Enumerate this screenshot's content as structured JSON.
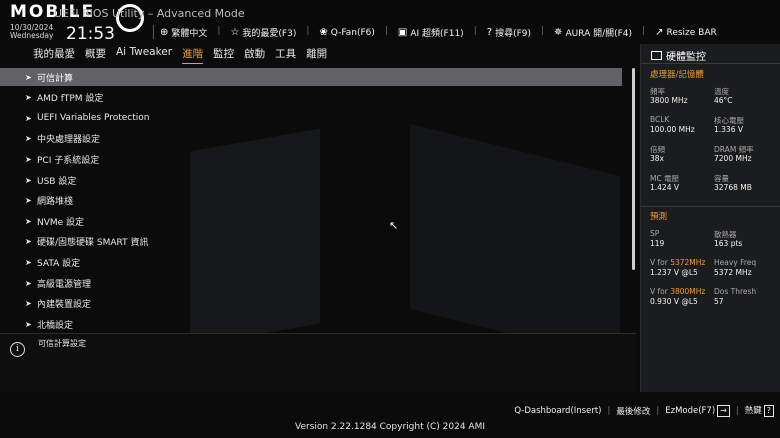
{
  "header": {
    "logo": "MOBILE",
    "bios_title": "UEFI BIOS Utility – Advanced Mode",
    "date": "10/30/2024",
    "weekday": "Wednesday",
    "time": "21:53"
  },
  "toolbar": [
    {
      "icon": "globe-icon",
      "glyph": "⊕",
      "label": "繁體中文"
    },
    {
      "icon": "star-icon",
      "glyph": "☆",
      "label": "我的最愛(F3)"
    },
    {
      "icon": "fan-icon",
      "glyph": "❀",
      "label": "Q-Fan(F6)"
    },
    {
      "icon": "ai-icon",
      "glyph": "▣",
      "label": "AI 超頻(F11)"
    },
    {
      "icon": "search-icon",
      "glyph": "?",
      "label": "搜尋(F9)"
    },
    {
      "icon": "aura-icon",
      "glyph": "✵",
      "label": "AURA 開/關(F4)"
    },
    {
      "icon": "resize-icon",
      "glyph": "↗",
      "label": "Resize BAR"
    }
  ],
  "tabs": [
    {
      "label": "我的最愛",
      "active": false
    },
    {
      "label": "概要",
      "active": false
    },
    {
      "label": "Ai Tweaker",
      "active": false
    },
    {
      "label": "進階",
      "active": true
    },
    {
      "label": "監控",
      "active": false
    },
    {
      "label": "啟動",
      "active": false
    },
    {
      "label": "工具",
      "active": false
    },
    {
      "label": "離開",
      "active": false
    }
  ],
  "menu_items": [
    {
      "label": "可信計算",
      "selected": true
    },
    {
      "label": "AMD fTPM 設定",
      "selected": false
    },
    {
      "label": "UEFI Variables Protection",
      "selected": false
    },
    {
      "label": "中央處理器設定",
      "selected": false
    },
    {
      "label": "PCI 子系統設定",
      "selected": false
    },
    {
      "label": "USB 設定",
      "selected": false
    },
    {
      "label": "網路堆棧",
      "selected": false
    },
    {
      "label": "NVMe 設定",
      "selected": false
    },
    {
      "label": "硬碟/固態硬碟 SMART 資訊",
      "selected": false
    },
    {
      "label": "SATA 設定",
      "selected": false
    },
    {
      "label": "高級電源管理",
      "selected": false
    },
    {
      "label": "內建裝置設定",
      "selected": false
    },
    {
      "label": "北橋設定",
      "selected": false
    }
  ],
  "help": {
    "text": "可信計算設定"
  },
  "monitor": {
    "title": "硬體監控",
    "section_cpu": "處理器/記憶體",
    "cpu": [
      {
        "label": "頻率",
        "value": "3800 MHz"
      },
      {
        "label": "溫度",
        "value": "46°C"
      },
      {
        "label": "BCLK",
        "value": "100.00 MHz"
      },
      {
        "label": "核心電壓",
        "value": "1.336 V"
      },
      {
        "label": "倍頻",
        "value": "38x"
      },
      {
        "label": "DRAM 頻率",
        "value": "7200 MHz"
      },
      {
        "label": "MC 電壓",
        "value": "1.424 V"
      },
      {
        "label": "容量",
        "value": "32768 MB"
      }
    ],
    "section_predict": "預測",
    "predict": [
      {
        "label": "SP",
        "value": "119"
      },
      {
        "label": "散熱器",
        "value": "163 pts"
      },
      {
        "label_prefix": "V for ",
        "label_hl": "5372MHz",
        "value": "1.237 V @L5"
      },
      {
        "label": "Heavy Freq",
        "value": "5372 MHz"
      },
      {
        "label_prefix": "V for ",
        "label_hl": "3800MHz",
        "value": "0.930 V @L5"
      },
      {
        "label": "Dos Thresh",
        "value": "57"
      }
    ]
  },
  "footer": {
    "qdash": "Q-Dashboard(Insert)",
    "last": "最後修改",
    "ezmode": "EzMode(F7)",
    "ezmode_glyph": "→",
    "hotkey": "熱鍵",
    "hotkey_glyph": "?",
    "copyright": "Version 2.22.1284 Copyright (C) 2024 AMI"
  },
  "colors": {
    "accent": "#f09a2c",
    "selected_row": "#606266",
    "panel": "#1b1c1e"
  }
}
